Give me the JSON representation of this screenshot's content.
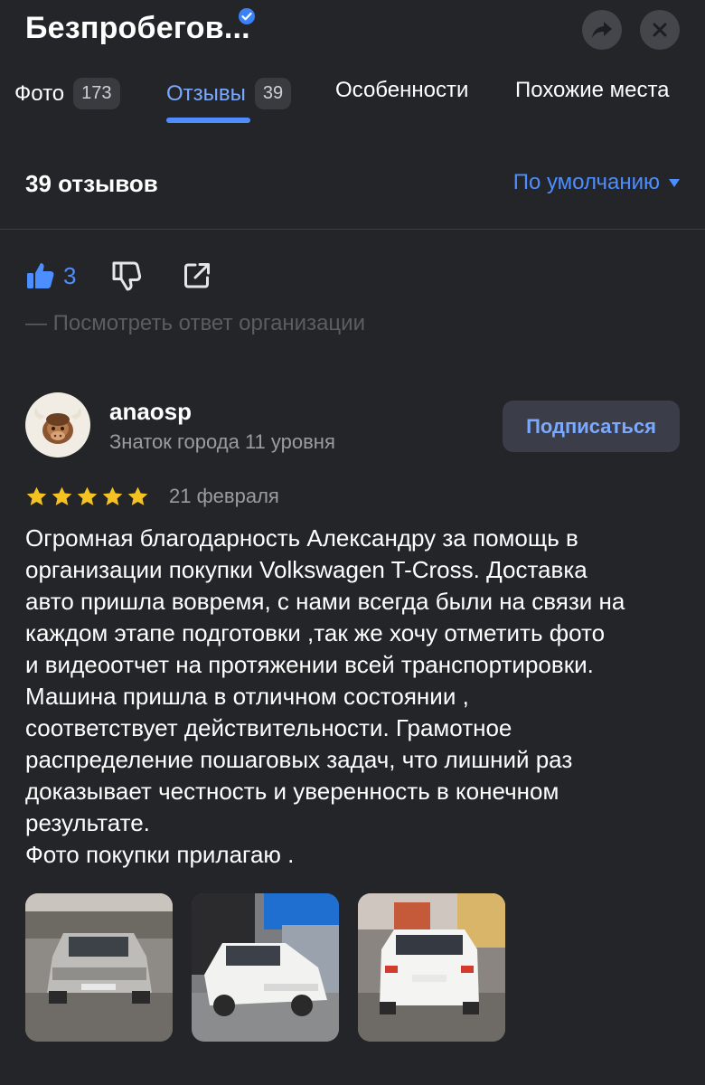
{
  "header": {
    "title": "Безпробегов...",
    "share_icon": "share-arrow-icon",
    "close_icon": "close-icon"
  },
  "tabs": [
    {
      "label": "Фото",
      "count": "173"
    },
    {
      "label": "Отзывы",
      "count": "39",
      "active": true
    },
    {
      "label": "Особенности"
    },
    {
      "label": "Похожие места"
    }
  ],
  "reviews": {
    "count_label": "39 отзывов",
    "sort_label": "По умолчанию"
  },
  "prev_review": {
    "likes": "3",
    "org_reply_link": "— Посмотреть ответ организации"
  },
  "review": {
    "author": "anaosp",
    "author_level": "Знаток города 11 уровня",
    "subscribe_label": "Подписаться",
    "rating": 5,
    "date": "21 февраля",
    "text_lines": [
      "Огромная благодарность Александру за помощь в",
      "организации покупки Volkswagen T-Cross. Доставка",
      "авто пришла вовремя, с нами всегда были на связи на",
      "каждом этапе подготовки ,так же хочу отметить фото",
      "и видеоотчет на протяжении всей транспортировки.",
      "Машина пришла в отличном состоянии ,",
      "соответствует действительности. Грамотное",
      "распределение пошаговых задач, что лишний раз",
      "доказывает честность и уверенность в конечном",
      "результате.",
      "Фото покупки прилагаю ."
    ]
  },
  "colors": {
    "background": "#242529",
    "accent": "#4d8eff",
    "star": "#f5c223"
  }
}
